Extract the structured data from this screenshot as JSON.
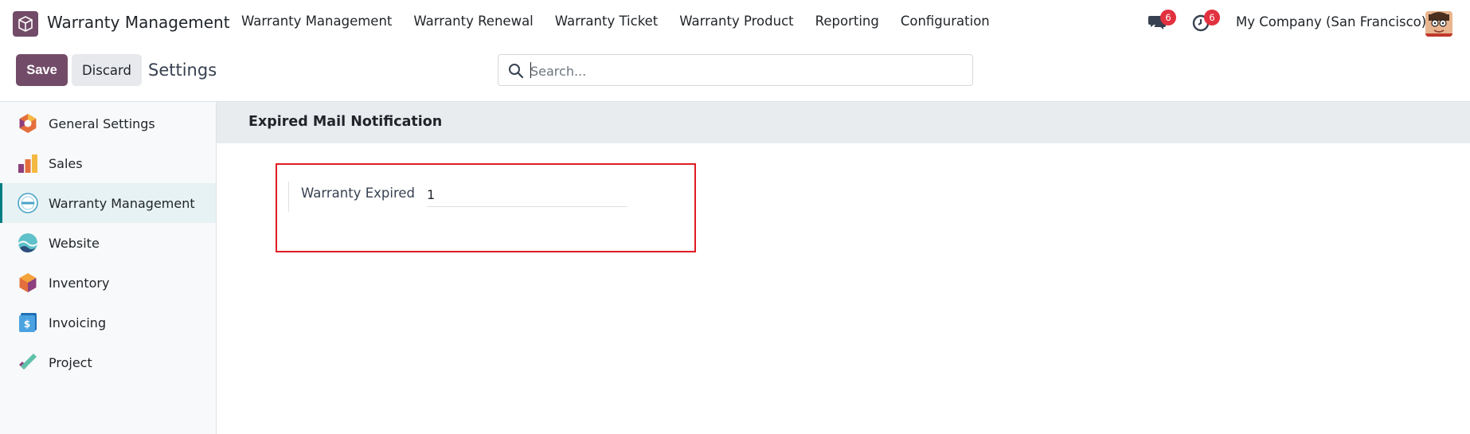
{
  "navbar": {
    "app_name": "Warranty Management",
    "menu": [
      {
        "label": "Warranty Management"
      },
      {
        "label": "Warranty Renewal"
      },
      {
        "label": "Warranty Ticket"
      },
      {
        "label": "Warranty Product"
      },
      {
        "label": "Reporting"
      },
      {
        "label": "Configuration"
      }
    ],
    "messages_count": "6",
    "activities_count": "6",
    "company": "My Company (San Francisco)"
  },
  "control": {
    "save_label": "Save",
    "discard_label": "Discard",
    "title": "Settings",
    "search_placeholder": "Search..."
  },
  "sidebar": {
    "items": [
      {
        "label": "General Settings",
        "icon": "general-settings-icon"
      },
      {
        "label": "Sales",
        "icon": "sales-icon"
      },
      {
        "label": "Warranty Management",
        "icon": "warranty-management-icon",
        "active": true
      },
      {
        "label": "Website",
        "icon": "website-icon"
      },
      {
        "label": "Inventory",
        "icon": "inventory-icon"
      },
      {
        "label": "Invoicing",
        "icon": "invoicing-icon"
      },
      {
        "label": "Project",
        "icon": "project-icon"
      }
    ]
  },
  "main": {
    "section_title": "Expired Mail Notification",
    "setting_label": "Warranty Expired",
    "setting_value": "1"
  },
  "colors": {
    "brand": "#714B67",
    "accent": "#017e84",
    "badge": "#e2313f",
    "highlight": "#e01b24"
  }
}
